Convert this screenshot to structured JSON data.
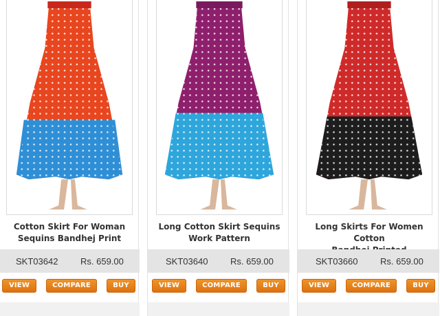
{
  "products": [
    {
      "title_line1": "Cotton Skirt For Woman",
      "title_line2": "Sequins Bandhej Print",
      "sku": "SKT03642",
      "price": "Rs. 659.00",
      "image_icon": "orange-blue-bandhej-skirt-image",
      "colors": {
        "top": "#e8461f",
        "bottom": "#2f8fd6",
        "waist": "#c8281c"
      }
    },
    {
      "title_line1": "Long Cotton Skirt Sequins",
      "title_line2": "Work Pattern",
      "sku": "SKT03640",
      "price": "Rs. 659.00",
      "image_icon": "purple-blue-bandhej-skirt-image",
      "colors": {
        "top": "#8e1f6c",
        "bottom": "#2ea6dc",
        "waist": "#7a1a5e"
      }
    },
    {
      "title_line1": "Long Skirts For Women Cotton",
      "title_line2": "Bandhej Printed",
      "sku": "SKT03660",
      "price": "Rs. 659.00",
      "image_icon": "red-black-bandhej-skirt-image",
      "colors": {
        "top": "#cf2a2a",
        "bottom": "#1d1d1d",
        "waist": "#b01f20"
      }
    }
  ],
  "buttons": {
    "view": "VIEW",
    "compare": "COMPARE",
    "buy": "BUY"
  },
  "theme": {
    "button_orange": "#e8831d",
    "price_bar": "#e4e4e4"
  }
}
